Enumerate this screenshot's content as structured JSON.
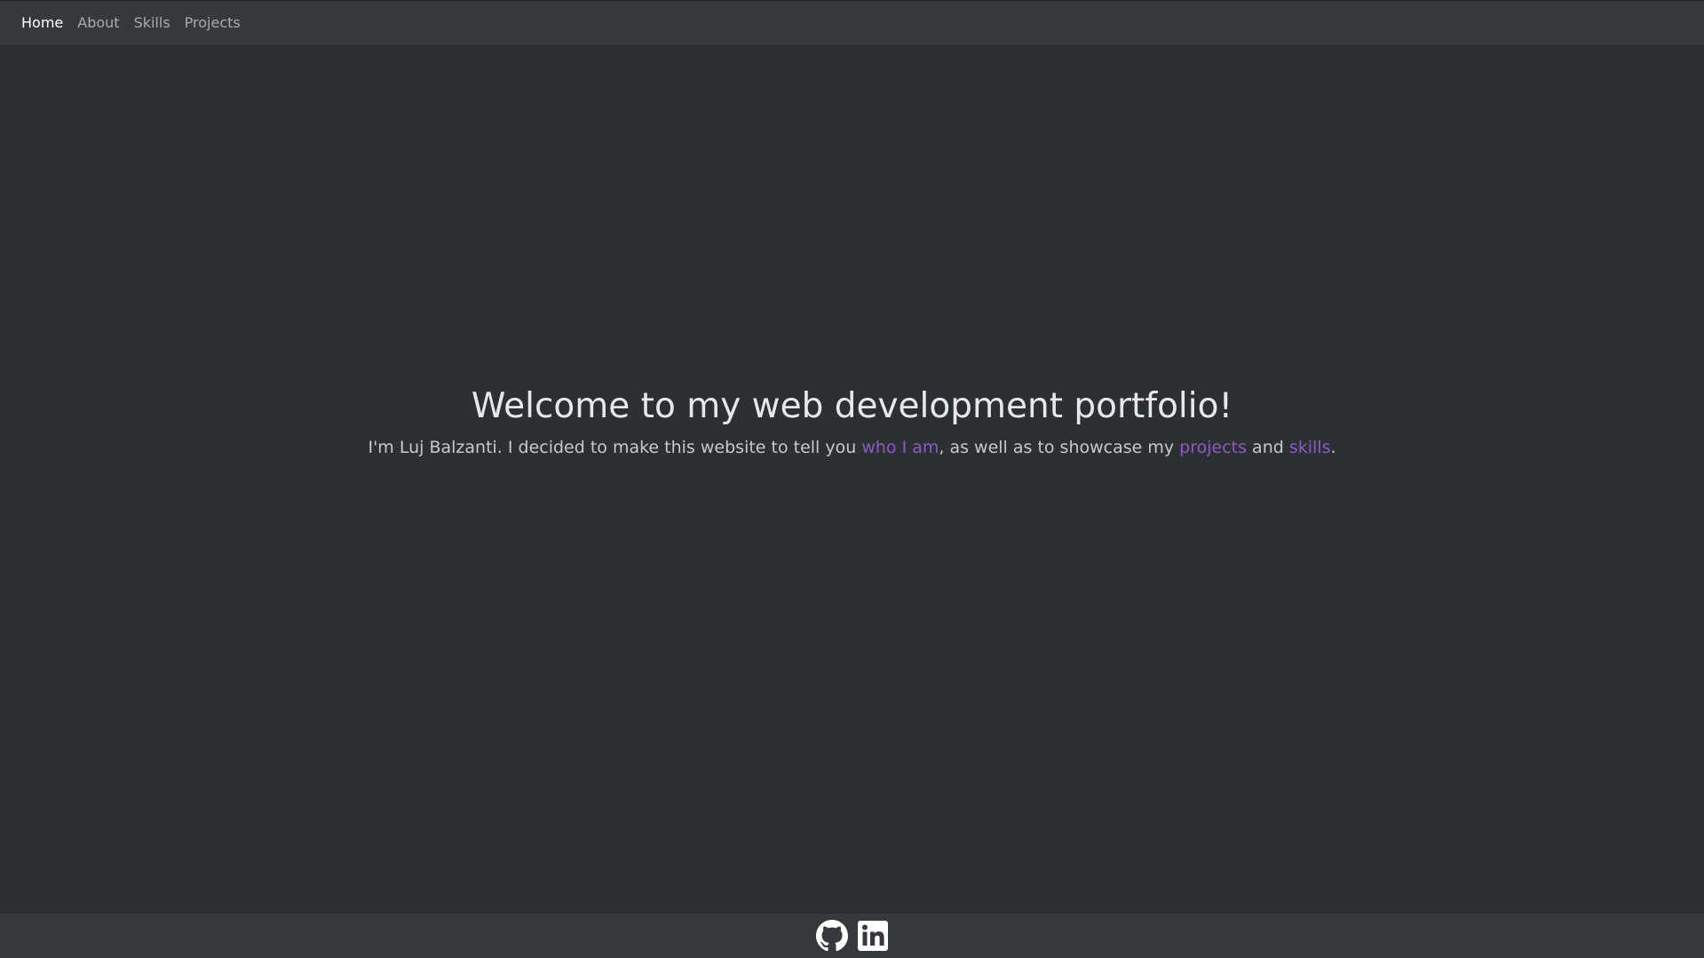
{
  "nav": {
    "items": [
      {
        "label": "Home",
        "active": true
      },
      {
        "label": "About",
        "active": false
      },
      {
        "label": "Skills",
        "active": false
      },
      {
        "label": "Projects",
        "active": false
      }
    ]
  },
  "hero": {
    "title": "Welcome to my web development portfolio!",
    "text_part1": "I'm Luj Balzanti. I decided to make this website to tell you ",
    "link_who": "who I am",
    "text_part2": ", as well as to showcase my ",
    "link_projects": "projects",
    "text_part3": " and ",
    "link_skills": "skills",
    "text_part4": "."
  },
  "footer": {
    "icons": [
      "github-icon",
      "linkedin-icon"
    ]
  },
  "colors": {
    "background": "#2c2f34",
    "bar": "#35383d",
    "link": "#8a5cc2",
    "text": "#e8e8e8"
  }
}
